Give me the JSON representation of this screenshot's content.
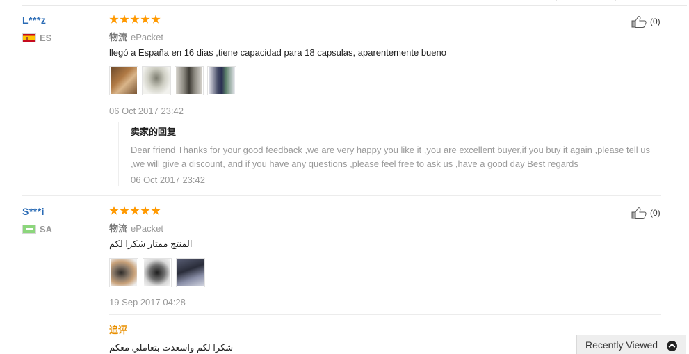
{
  "reviews": [
    {
      "user": "L***z",
      "country_code": "ES",
      "flag_icon": "spain-flag-icon",
      "rating_stars": 5,
      "shipping_label": "物流",
      "shipping_method": "ePacket",
      "comment": "llegó a España en 16 dias ,tiene capacidad para 18 capsulas, aparentemente bueno",
      "photo_count": 4,
      "date": "06 Oct 2017 23:42",
      "helpful_count": "(0)",
      "seller_reply": {
        "title": "卖家的回复",
        "text": "Dear friend Thanks for your good feedback ,we are very happy you like it ,you are excellent buyer,if you buy it again ,please tell us ,we will give a discount, and if you have any questions ,please feel free to ask us ,have a good day Best regards",
        "date": "06 Oct 2017 23:42"
      }
    },
    {
      "user": "S***i",
      "country_code": "SA",
      "flag_icon": "saudi-arabia-flag-icon",
      "rating_stars": 5,
      "shipping_label": "物流",
      "shipping_method": "ePacket",
      "comment": "المنتج ممتاز شكرا لكم",
      "photo_count": 3,
      "date": "19 Sep 2017 04:28",
      "helpful_count": "(0)",
      "followup": {
        "label": "追评",
        "text": "شكرا لكم واسعدت بتعاملي معكم"
      }
    }
  ],
  "recently_viewed": {
    "label": "Recently Viewed",
    "icon": "chevron-up-circle-icon"
  },
  "colors": {
    "star": "#ff9900",
    "username": "#2a6bb5",
    "followup_label": "#e88f00",
    "muted_text": "#999999"
  }
}
